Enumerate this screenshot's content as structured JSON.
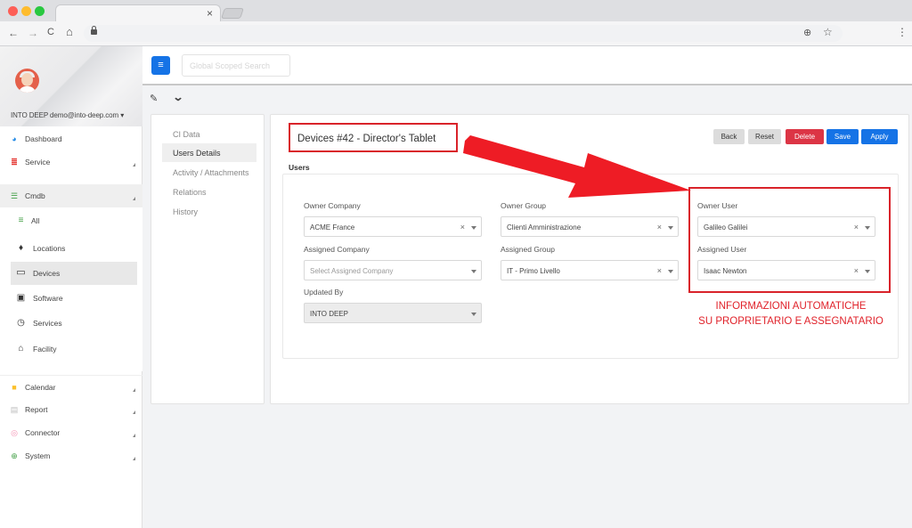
{
  "browser": {
    "tab_close": "×",
    "icons": [
      "back-icon",
      "forward-icon",
      "reload-icon",
      "home-icon",
      "lock-icon",
      "zoom-icon",
      "star-icon",
      "kebab-menu-icon"
    ],
    "nav": {
      "back": "←",
      "forward": "→",
      "reload": "C",
      "home": "⌂",
      "zoom": "⊕",
      "star": "☆",
      "menu": "⋮"
    }
  },
  "topbar": {
    "menu_glyph": "≡",
    "search_placeholder": "Global Scoped Search"
  },
  "sidebar": {
    "user": "INTO DEEP demo@into-deep.com ▾",
    "items": [
      {
        "label": "Dashboard",
        "icon": "palette-icon",
        "color": "#1e88e5"
      },
      {
        "label": "Service",
        "icon": "service-icon",
        "color": "#e53935"
      },
      {
        "label": "Cmdb",
        "icon": "database-icon",
        "color": "#43a047"
      },
      {
        "label": "Calendar",
        "icon": "calendar-icon",
        "color": "#fbc02d"
      },
      {
        "label": "Report",
        "icon": "report-icon",
        "color": "#bdbdbd"
      },
      {
        "label": "Connector",
        "icon": "connector-icon",
        "color": "#f48fb1"
      },
      {
        "label": "System",
        "icon": "globe-icon",
        "color": "#43a047"
      }
    ],
    "cmdb_sub": [
      {
        "label": "All",
        "icon": "list-icon"
      },
      {
        "label": "Locations",
        "icon": "pin-icon"
      },
      {
        "label": "Devices",
        "icon": "laptop-icon"
      },
      {
        "label": "Software",
        "icon": "software-icon"
      },
      {
        "label": "Services",
        "icon": "timer-icon"
      },
      {
        "label": "Facility",
        "icon": "building-icon"
      }
    ]
  },
  "tabs": [
    "CI Data",
    "Users Details",
    "Activity / Attachments",
    "Relations",
    "History"
  ],
  "main": {
    "title": "Devices #42 - Director's Tablet",
    "buttons": {
      "back": "Back",
      "reset": "Reset",
      "delete": "Delete",
      "save": "Save",
      "apply": "Apply"
    },
    "section": "Users",
    "fields": {
      "owner_company": {
        "label": "Owner Company",
        "value": "ACME France"
      },
      "owner_group": {
        "label": "Owner Group",
        "value": "Clienti Amministrazione"
      },
      "owner_user": {
        "label": "Owner User",
        "value": "Galileo Galilei"
      },
      "assigned_company": {
        "label": "Assigned Company",
        "placeholder": "Select Assigned Company"
      },
      "assigned_group": {
        "label": "Assigned Group",
        "value": "IT - Primo Livello"
      },
      "assigned_user": {
        "label": "Assigned User",
        "value": "Isaac Newton"
      },
      "updated_by": {
        "label": "Updated By",
        "value": "INTO DEEP"
      }
    },
    "clear_glyph": "×"
  },
  "annotation": {
    "line1": "INFORMAZIONI AUTOMATICHE",
    "line2": "SU PROPRIETARIO E ASSEGNATARIO",
    "color": "#e0222a"
  },
  "colors": {
    "primary": "#1573e6",
    "danger": "#dc3545",
    "annotation": "#d9232a"
  }
}
